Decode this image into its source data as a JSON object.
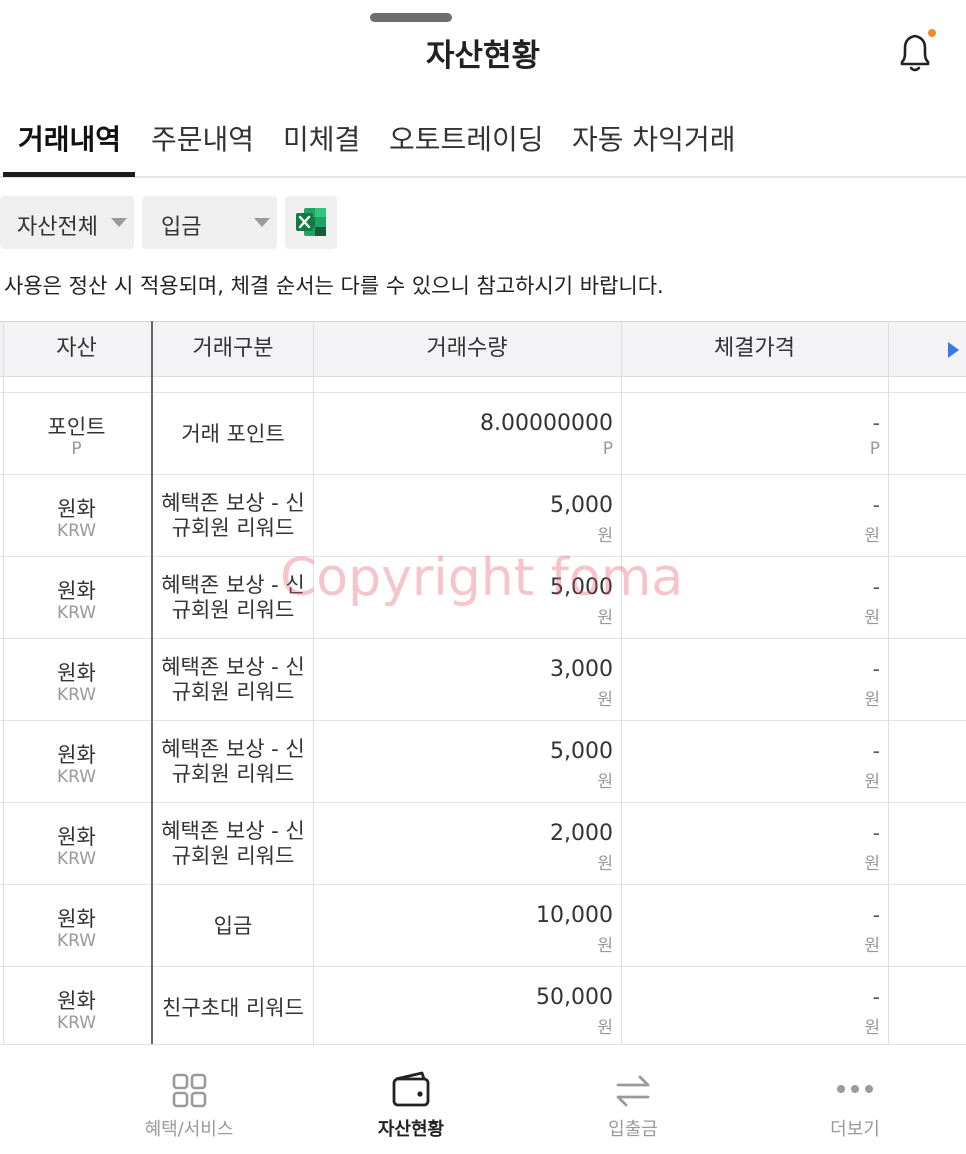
{
  "header": {
    "title": "자산현황",
    "notification_dot_color": "#f28c28"
  },
  "tabs": [
    {
      "label": "거래내역",
      "active": true
    },
    {
      "label": "주문내역",
      "active": false
    },
    {
      "label": "미체결",
      "active": false
    },
    {
      "label": "오토트레이딩",
      "active": false
    },
    {
      "label": "자동 차익거래",
      "active": false
    }
  ],
  "filters": {
    "asset_select": "자산전체",
    "type_select": "입금",
    "excel_icon": "excel-icon"
  },
  "notice": "사용은 정산 시 적용되며, 체결 순서는 다를 수 있으니 참고하시기 바랍니다.",
  "table": {
    "headers": [
      "자산",
      "거래구분",
      "거래수량",
      "체결가격"
    ],
    "rows": [
      {
        "asset": "포인트",
        "code": "P",
        "type": "거래 포인트",
        "qty": "8.00000000",
        "qty_unit": "P",
        "price": "-",
        "price_unit": "P"
      },
      {
        "asset": "원화",
        "code": "KRW",
        "type": "혜택존 보상 - 신규회원 리워드",
        "qty": "5,000",
        "qty_unit": "원",
        "price": "-",
        "price_unit": "원"
      },
      {
        "asset": "원화",
        "code": "KRW",
        "type": "혜택존 보상 - 신규회원 리워드",
        "qty": "5,000",
        "qty_unit": "원",
        "price": "-",
        "price_unit": "원"
      },
      {
        "asset": "원화",
        "code": "KRW",
        "type": "혜택존 보상 - 신규회원 리워드",
        "qty": "3,000",
        "qty_unit": "원",
        "price": "-",
        "price_unit": "원"
      },
      {
        "asset": "원화",
        "code": "KRW",
        "type": "혜택존 보상 - 신규회원 리워드",
        "qty": "5,000",
        "qty_unit": "원",
        "price": "-",
        "price_unit": "원"
      },
      {
        "asset": "원화",
        "code": "KRW",
        "type": "혜택존 보상 - 신규회원 리워드",
        "qty": "2,000",
        "qty_unit": "원",
        "price": "-",
        "price_unit": "원"
      },
      {
        "asset": "원화",
        "code": "KRW",
        "type": "입금",
        "qty": "10,000",
        "qty_unit": "원",
        "price": "-",
        "price_unit": "원"
      },
      {
        "asset": "원화",
        "code": "KRW",
        "type": "친구초대 리워드",
        "qty": "50,000",
        "qty_unit": "원",
        "price": "-",
        "price_unit": "원"
      }
    ]
  },
  "watermark": "Copyright foma",
  "bottom_nav": [
    {
      "label": "혜택/서비스",
      "icon": "grid-icon",
      "active": false
    },
    {
      "label": "자산현황",
      "icon": "wallet-icon",
      "active": true
    },
    {
      "label": "입출금",
      "icon": "transfer-arrows-icon",
      "active": false
    },
    {
      "label": "더보기",
      "icon": "more-dots-icon",
      "active": false
    }
  ]
}
